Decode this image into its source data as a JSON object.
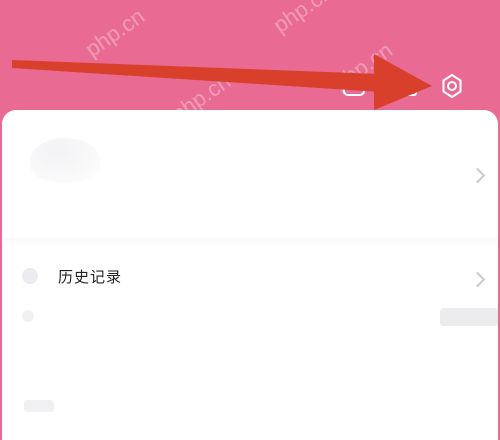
{
  "watermarks": [
    "php.cn",
    "php.cn",
    "php.cn",
    "php.cn"
  ],
  "menu": {
    "history_label": "历史记录"
  },
  "icons": {
    "scan": "scan-icon",
    "mail": "mail-icon",
    "settings": "gear-icon",
    "chevron": "chevron-right-icon"
  },
  "colors": {
    "header": "#e96b93",
    "arrow": "#d8402c",
    "card": "#ffffff"
  }
}
